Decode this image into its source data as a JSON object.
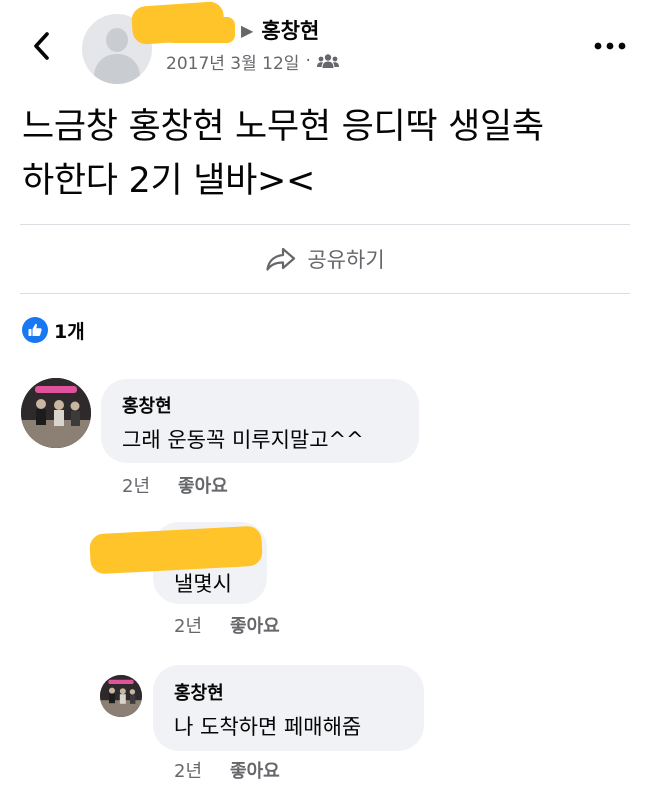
{
  "header": {
    "author": "홍창현",
    "date": "2017년 3월 12일",
    "separator": "·",
    "arrow": "▶"
  },
  "post": {
    "text_line1": "느금창 홍창현 노무현 응디딱 생일축",
    "text_line2": "하한다 2기 낼바><"
  },
  "share": {
    "label": "공유하기"
  },
  "reactions": {
    "count": "1개"
  },
  "comments": [
    {
      "name": "홍창현",
      "text": "그래 운동꼭 미루지말고^^",
      "time": "2년",
      "like": "좋아요"
    },
    {
      "name": "",
      "text": "낼몇시",
      "time": "2년",
      "like": "좋아요"
    },
    {
      "name": "홍창현",
      "text": "나 도착하면 페매해줌",
      "time": "2년",
      "like": "좋아요"
    }
  ],
  "colors": {
    "accent": "#1877f2",
    "redaction": "#ffc42a",
    "bubble": "#f0f2f5",
    "muted": "#65676b"
  }
}
